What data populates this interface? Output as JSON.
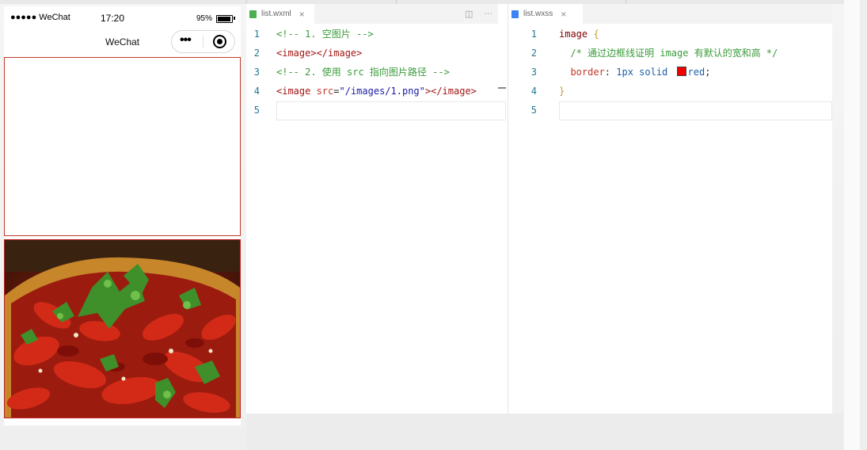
{
  "simulator": {
    "status_bar": {
      "carrier": "●●●●● WeChat",
      "time": "17:20",
      "battery": "95%"
    },
    "nav_title": "WeChat",
    "capsule": {
      "more_icon": "more-dots-icon",
      "close_icon": "target-icon"
    }
  },
  "editor": {
    "left_tab": {
      "label": "list.wxml",
      "close": "×"
    },
    "left_actions": {
      "split": "◫",
      "more": "···"
    },
    "right_tab": {
      "label": "list.wxss",
      "close": "×"
    },
    "left_lines": [
      {
        "num": "1",
        "parts": [
          [
            "c-comment",
            "<!-- 1. 空图片 -->"
          ]
        ]
      },
      {
        "num": "2",
        "parts": [
          [
            "c-tag",
            "<image></image>"
          ]
        ]
      },
      {
        "num": "3",
        "parts": [
          [
            "c-comment",
            "<!-- 2. 使用 src 指向图片路径 -->"
          ]
        ]
      },
      {
        "num": "4",
        "parts": [
          [
            "c-tag",
            "<image "
          ],
          [
            "c-attr",
            "src"
          ],
          [
            "c-plain",
            "="
          ],
          [
            "c-str",
            "\"/images/1.png\""
          ],
          [
            "c-tag",
            "></image>"
          ]
        ]
      },
      {
        "num": "5",
        "parts": []
      }
    ],
    "right_lines": [
      {
        "num": "1",
        "parts": [
          [
            "c-sel",
            "image "
          ],
          [
            "c-brace",
            "{"
          ]
        ]
      },
      {
        "num": "2",
        "parts": [
          [
            "c-comment",
            "  /* 通过边框线证明 image 有默认的宽和高 */"
          ]
        ]
      },
      {
        "num": "3",
        "parts": [
          [
            "c-prop",
            "  border"
          ],
          [
            "c-plain",
            ": "
          ],
          [
            "c-val",
            "1px solid "
          ],
          [
            "swatch",
            ""
          ],
          [
            "c-val",
            "red"
          ],
          [
            "c-plain",
            ";"
          ]
        ]
      },
      {
        "num": "4",
        "parts": [
          [
            "c-brace",
            "}"
          ]
        ]
      },
      {
        "num": "5",
        "parts": []
      }
    ]
  },
  "colors": {
    "border_red": "#c0392b",
    "comment": "#3a9b3a",
    "line_number": "#237893"
  }
}
